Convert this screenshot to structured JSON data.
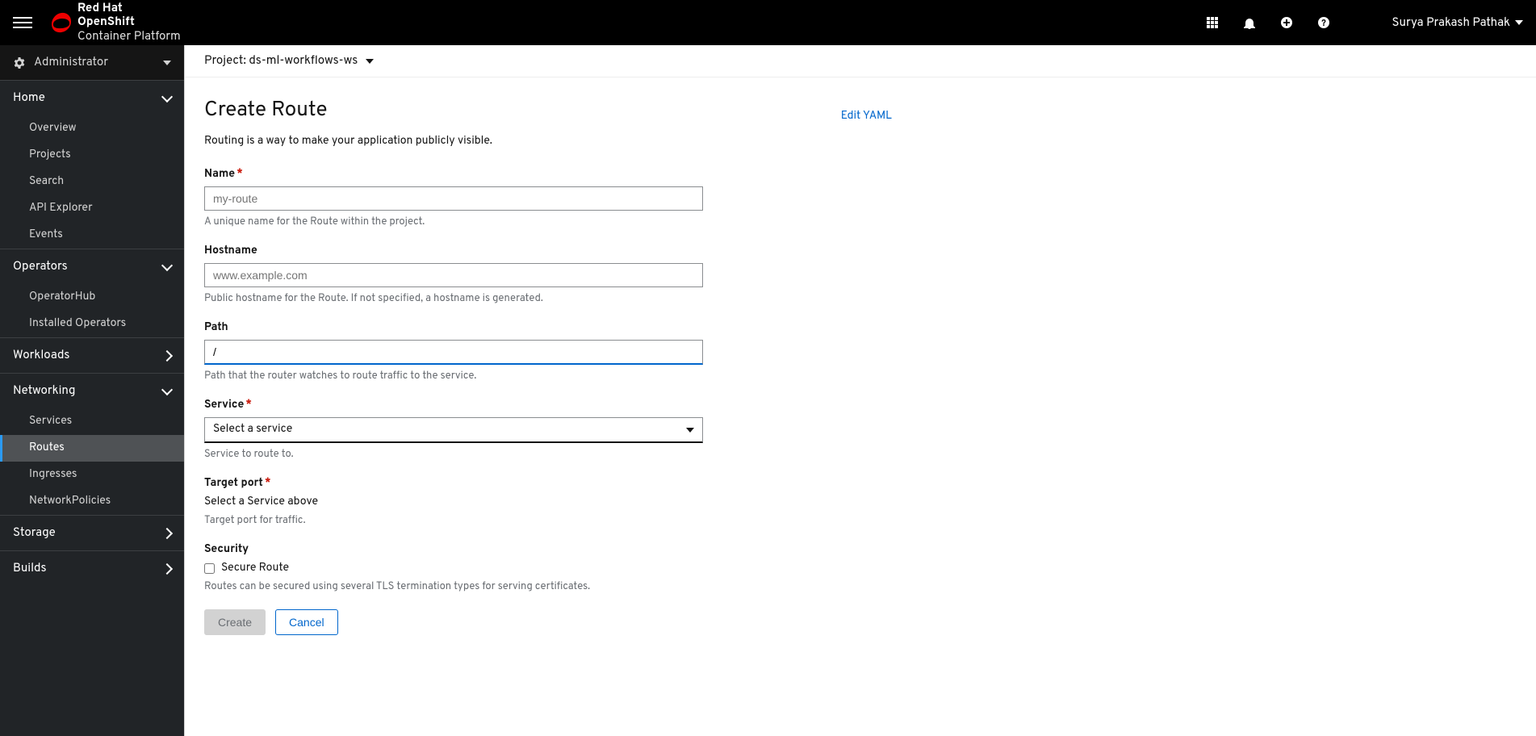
{
  "header": {
    "brand_line1": "Red Hat",
    "brand_line2": "OpenShift",
    "brand_line3": "Container Platform",
    "user_name": "Surya Prakash Pathak"
  },
  "sidebar": {
    "perspective_label": "Administrator",
    "sections": {
      "home": {
        "label": "Home",
        "items": [
          "Overview",
          "Projects",
          "Search",
          "API Explorer",
          "Events"
        ]
      },
      "operators": {
        "label": "Operators",
        "items": [
          "OperatorHub",
          "Installed Operators"
        ]
      },
      "workloads": {
        "label": "Workloads"
      },
      "networking": {
        "label": "Networking",
        "items": [
          "Services",
          "Routes",
          "Ingresses",
          "NetworkPolicies"
        ]
      },
      "storage": {
        "label": "Storage"
      },
      "builds": {
        "label": "Builds"
      }
    },
    "active_item": "Routes"
  },
  "project_bar": {
    "label": "Project",
    "value": "ds-ml-workflows-ws"
  },
  "page": {
    "title": "Create Route",
    "edit_yaml": "Edit YAML",
    "description": "Routing is a way to make your application publicly visible."
  },
  "form": {
    "name": {
      "label": "Name",
      "required": true,
      "placeholder": "my-route",
      "value": "",
      "help": "A unique name for the Route within the project."
    },
    "hostname": {
      "label": "Hostname",
      "required": false,
      "placeholder": "www.example.com",
      "value": "",
      "help": "Public hostname for the Route. If not specified, a hostname is generated."
    },
    "path": {
      "label": "Path",
      "required": false,
      "placeholder": "",
      "value": "/",
      "help": "Path that the router watches to route traffic to the service."
    },
    "service": {
      "label": "Service",
      "required": true,
      "placeholder": "Select a service",
      "help": "Service to route to."
    },
    "target_port": {
      "label": "Target port",
      "required": true,
      "value_text": "Select a Service above",
      "help": "Target port for traffic."
    },
    "security": {
      "label": "Security",
      "checkbox_label": "Secure Route",
      "checked": false,
      "help": "Routes can be secured using several TLS termination types for serving certificates."
    }
  },
  "actions": {
    "create": "Create",
    "cancel": "Cancel"
  }
}
